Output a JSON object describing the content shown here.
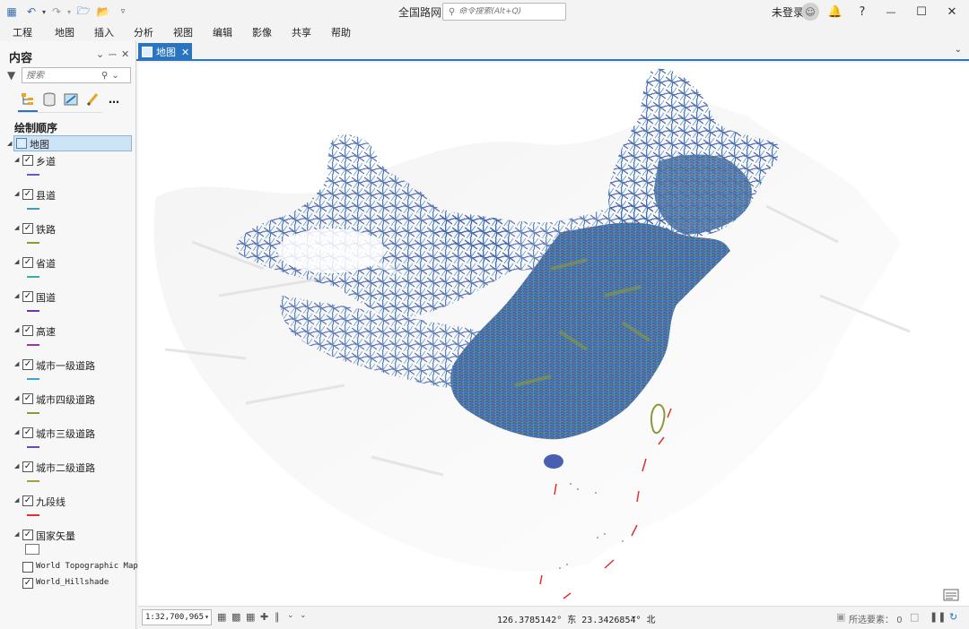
{
  "app": {
    "title": "全国路网",
    "command_search_placeholder": "命令搜索(Alt+Q)",
    "signin_label": "未登录"
  },
  "menu": [
    "工程",
    "地图",
    "插入",
    "分析",
    "视图",
    "编辑",
    "影像",
    "共享",
    "帮助"
  ],
  "contents_panel": {
    "title": "内容",
    "search_placeholder": "搜索",
    "drawing_order_label": "绘制顺序",
    "map_node_label": "地图",
    "layers": [
      {
        "name": "乡道",
        "checked": true,
        "symbol_color": "#6a5acd"
      },
      {
        "name": "县道",
        "checked": true,
        "symbol_color": "#3aa0b8"
      },
      {
        "name": "铁路",
        "checked": true,
        "symbol_color": "#8a9a3a"
      },
      {
        "name": "省道",
        "checked": true,
        "symbol_color": "#3ab0a0"
      },
      {
        "name": "国道",
        "checked": true,
        "symbol_color": "#6a3aa0"
      },
      {
        "name": "高速",
        "checked": true,
        "symbol_color": "#9a3aa0"
      },
      {
        "name": "城市一级道路",
        "checked": true,
        "symbol_color": "#3aa8c8"
      },
      {
        "name": "城市四级道路",
        "checked": true,
        "symbol_color": "#8a9a3a"
      },
      {
        "name": "城市三级道路",
        "checked": true,
        "symbol_color": "#6a4ab0"
      },
      {
        "name": "城市二级道路",
        "checked": true,
        "symbol_color": "#a0a040"
      },
      {
        "name": "九段线",
        "checked": true,
        "symbol_color": "#e03030"
      },
      {
        "name": "国家矢量",
        "checked": true,
        "symbol_color": "#ffffff"
      }
    ],
    "basemaps": [
      {
        "name": "World Topographic Map",
        "checked": false
      },
      {
        "name": "World_Hillshade",
        "checked": true
      }
    ]
  },
  "map_tab": {
    "label": "地图"
  },
  "status": {
    "scale": "1:32,700,965",
    "coordinates": "126.3785142° 东 23.3426854° 北",
    "selected_label": "所选要素：",
    "selected_count": "0"
  },
  "colors": {
    "accent": "#2a74c0",
    "road_main": "#4a5fb0",
    "road_teal": "#3aa0b8",
    "road_olive": "#8a9a3a",
    "nine_dash": "#e03030"
  }
}
